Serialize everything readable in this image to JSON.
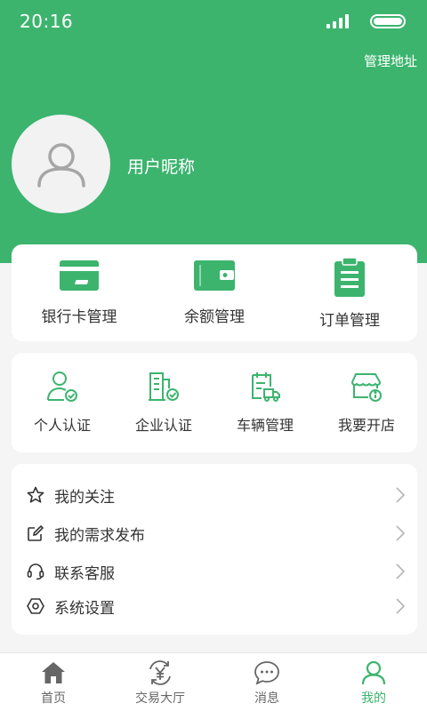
{
  "status_bar": {
    "time": "20:16"
  },
  "header": {
    "manage_address": "管理地址",
    "nickname": "用户昵称",
    "avatar_icon": "user-avatar-icon"
  },
  "colors": {
    "primary": "#3cb46e",
    "background": "#f5f5f5",
    "text": "#333333"
  },
  "finance_menu": [
    {
      "label": "银行卡管理",
      "icon": "bank-card-icon"
    },
    {
      "label": "余额管理",
      "icon": "wallet-icon"
    },
    {
      "label": "订单管理",
      "icon": "clipboard-icon"
    }
  ],
  "service_menu": [
    {
      "label": "个人认证",
      "icon": "personal-verify-icon"
    },
    {
      "label": "企业认证",
      "icon": "enterprise-verify-icon"
    },
    {
      "label": "车辆管理",
      "icon": "vehicle-icon"
    },
    {
      "label": "我要开店",
      "icon": "open-shop-icon"
    }
  ],
  "settings_list": [
    {
      "label": "我的关注",
      "icon": "star-icon"
    },
    {
      "label": "我的需求发布",
      "icon": "edit-icon"
    },
    {
      "label": "联系客服",
      "icon": "headset-icon"
    },
    {
      "label": "系统设置",
      "icon": "hexagon-settings-icon"
    }
  ],
  "tabbar": [
    {
      "label": "首页",
      "icon": "home-icon",
      "active": false
    },
    {
      "label": "交易大厅",
      "icon": "yuan-exchange-icon",
      "active": false
    },
    {
      "label": "消息",
      "icon": "message-icon",
      "active": false
    },
    {
      "label": "我的",
      "icon": "profile-icon",
      "active": true
    }
  ]
}
